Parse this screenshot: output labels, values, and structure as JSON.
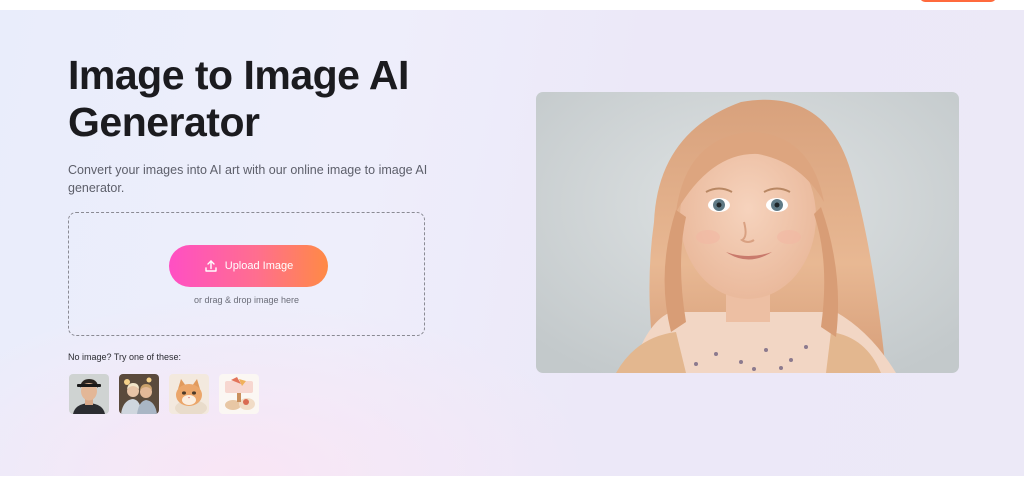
{
  "hero": {
    "title_line1": "Image to Image AI",
    "title_line2": "Generator",
    "subtitle": "Convert your images into AI art with our online image to image AI generator."
  },
  "upload": {
    "button_label": "Upload Image",
    "drop_hint": "or drag & drop image here",
    "icon": "upload-icon"
  },
  "samples": {
    "label": "No image? Try one of these:",
    "items": [
      {
        "name": "sample-portrait-man"
      },
      {
        "name": "sample-group-photo"
      },
      {
        "name": "sample-cat"
      },
      {
        "name": "sample-food"
      }
    ]
  },
  "preview": {
    "subject": "smiling-girl-portrait"
  },
  "colors": {
    "button_gradient_start": "#ff4fc4",
    "button_gradient_end": "#ff8a45",
    "title": "#1b1b1f",
    "top_cta": "#ff6a3d"
  }
}
